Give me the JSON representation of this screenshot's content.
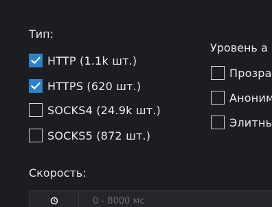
{
  "type_filter": {
    "label": "Тип:",
    "options": [
      {
        "label": "HTTP (1.1k шт.)",
        "checked": true
      },
      {
        "label": "HTTPS (620 шт.)",
        "checked": true
      },
      {
        "label": "SOCKS4 (24.9k шт.)",
        "checked": false
      },
      {
        "label": "SOCKS5 (872 шт.)",
        "checked": false
      }
    ]
  },
  "anonymity_filter": {
    "label": "Уровень а",
    "options": [
      {
        "label": "Прозра",
        "checked": false
      },
      {
        "label": "Аноним",
        "checked": false
      },
      {
        "label": "Элитны",
        "checked": false
      }
    ]
  },
  "speed": {
    "label": "Скорость:",
    "placeholder": "0 - 8000 мс",
    "icon": "clock-icon"
  },
  "colors": {
    "background": "#1c1d21",
    "checkbox_checked": "#2c82c9",
    "text": "#ececec"
  }
}
